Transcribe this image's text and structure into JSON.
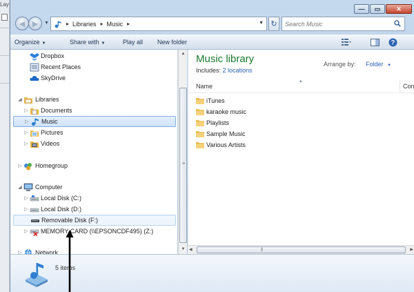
{
  "background_app": {
    "menu_text": "Lay"
  },
  "window": {
    "controls": {
      "minimize": "—",
      "maximize": "▭",
      "close": "✕"
    }
  },
  "address_bar": {
    "crumbs": [
      "Libraries",
      "Music"
    ],
    "search_placeholder": "Search Music"
  },
  "command_bar": {
    "organize": "Organize",
    "share_with": "Share with",
    "play_all": "Play all",
    "new_folder": "New folder"
  },
  "nav": {
    "favorites": [
      {
        "label": "Dropbox",
        "icon": "dropbox-icon"
      },
      {
        "label": "Recent Places",
        "icon": "recent-places-icon"
      },
      {
        "label": "SkyDrive",
        "icon": "skydrive-icon"
      }
    ],
    "libraries": {
      "label": "Libraries",
      "items": [
        {
          "label": "Documents",
          "icon": "documents-icon"
        },
        {
          "label": "Music",
          "icon": "music-icon",
          "selected": true
        },
        {
          "label": "Pictures",
          "icon": "pictures-icon"
        },
        {
          "label": "Videos",
          "icon": "videos-icon"
        }
      ]
    },
    "homegroup": {
      "label": "Homegroup"
    },
    "computer": {
      "label": "Computer",
      "items": [
        {
          "label": "Local Disk (C:)"
        },
        {
          "label": "Local Disk (D:)"
        },
        {
          "label": "Removable Disk (F:)",
          "hover": true
        },
        {
          "label": "MEMORY CARD (\\\\EPSONCDF495) (Z:)"
        }
      ]
    },
    "network": {
      "label": "Network"
    }
  },
  "content": {
    "title": "Music library",
    "includes_label": "Includes:",
    "includes_link": "2 locations",
    "arrange_label": "Arrange by:",
    "arrange_value": "Folder",
    "columns": {
      "name": "Name",
      "next": "Con"
    },
    "files": [
      {
        "label": "iTunes",
        "type": "folder"
      },
      {
        "label": "karaoke music",
        "type": "folder"
      },
      {
        "label": "Playlists",
        "type": "folder"
      },
      {
        "label": "Sample Music",
        "type": "folder"
      },
      {
        "label": "Various Artists",
        "type": "folder"
      }
    ]
  },
  "details": {
    "item_count": "5 items"
  },
  "colors": {
    "library_title": "#1a7a2e",
    "link": "#2a61b7",
    "folder": "#e8b84a",
    "annotation_arrow": "#000000"
  }
}
